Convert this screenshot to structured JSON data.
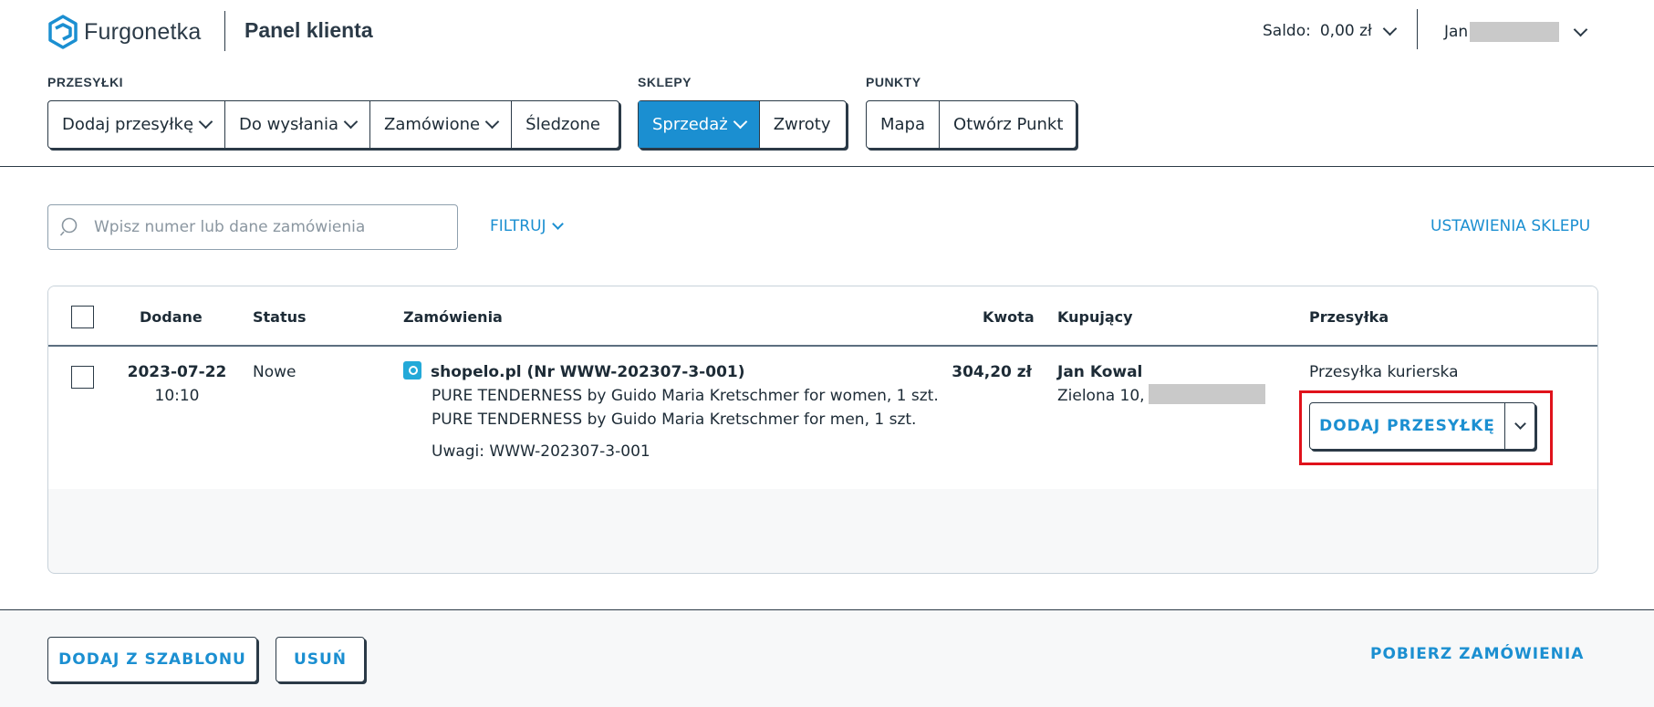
{
  "header": {
    "brand": "Furgonetka",
    "title": "Panel klienta",
    "saldo_label": "Saldo:",
    "saldo_value": "0,00 zł",
    "user_name": "Jan"
  },
  "nav": {
    "groups": [
      {
        "label": "PRZESYŁKI",
        "items": [
          "Dodaj przesyłkę",
          "Do wysłania",
          "Zamówione",
          "Śledzone"
        ]
      },
      {
        "label": "SKLEPY",
        "items": [
          "Sprzedaż",
          "Zwroty"
        ]
      },
      {
        "label": "PUNKTY",
        "items": [
          "Mapa",
          "Otwórz Punkt"
        ]
      }
    ]
  },
  "toolbar": {
    "search_placeholder": "Wpisz numer lub dane zamówienia",
    "filter_label": "FILTRUJ",
    "settings_label": "USTAWIENIA SKLEPU"
  },
  "table": {
    "columns": [
      "Dodane",
      "Status",
      "Zamówienia",
      "Kwota",
      "Kupujący",
      "Przesyłka"
    ],
    "rows": [
      {
        "date": "2023-07-22",
        "time": "10:10",
        "status": "Nowe",
        "order_title": "shopelo.pl (Nr WWW-202307-3-001)",
        "items": [
          "PURE TENDERNESS by Guido Maria Kretschmer for women, 1 szt.",
          "PURE TENDERNESS by Guido Maria Kretschmer for men, 1 szt."
        ],
        "notes": "Uwagi: WWW-202307-3-001",
        "amount": "304,20 zł",
        "buyer_name": "Jan Kowal",
        "buyer_address": "Zielona 10,",
        "shipment_type": "Przesyłka kurierska",
        "action_label": "DODAJ PRZESYŁKĘ"
      }
    ]
  },
  "footer": {
    "template_button": "DODAJ Z SZABLONU",
    "delete_button": "USUŃ",
    "fetch_orders": "POBIERZ ZAMÓWIENIA"
  },
  "colors": {
    "accent": "#1b8fd1",
    "dark": "#2b3a47",
    "highlight": "#e0121b"
  }
}
